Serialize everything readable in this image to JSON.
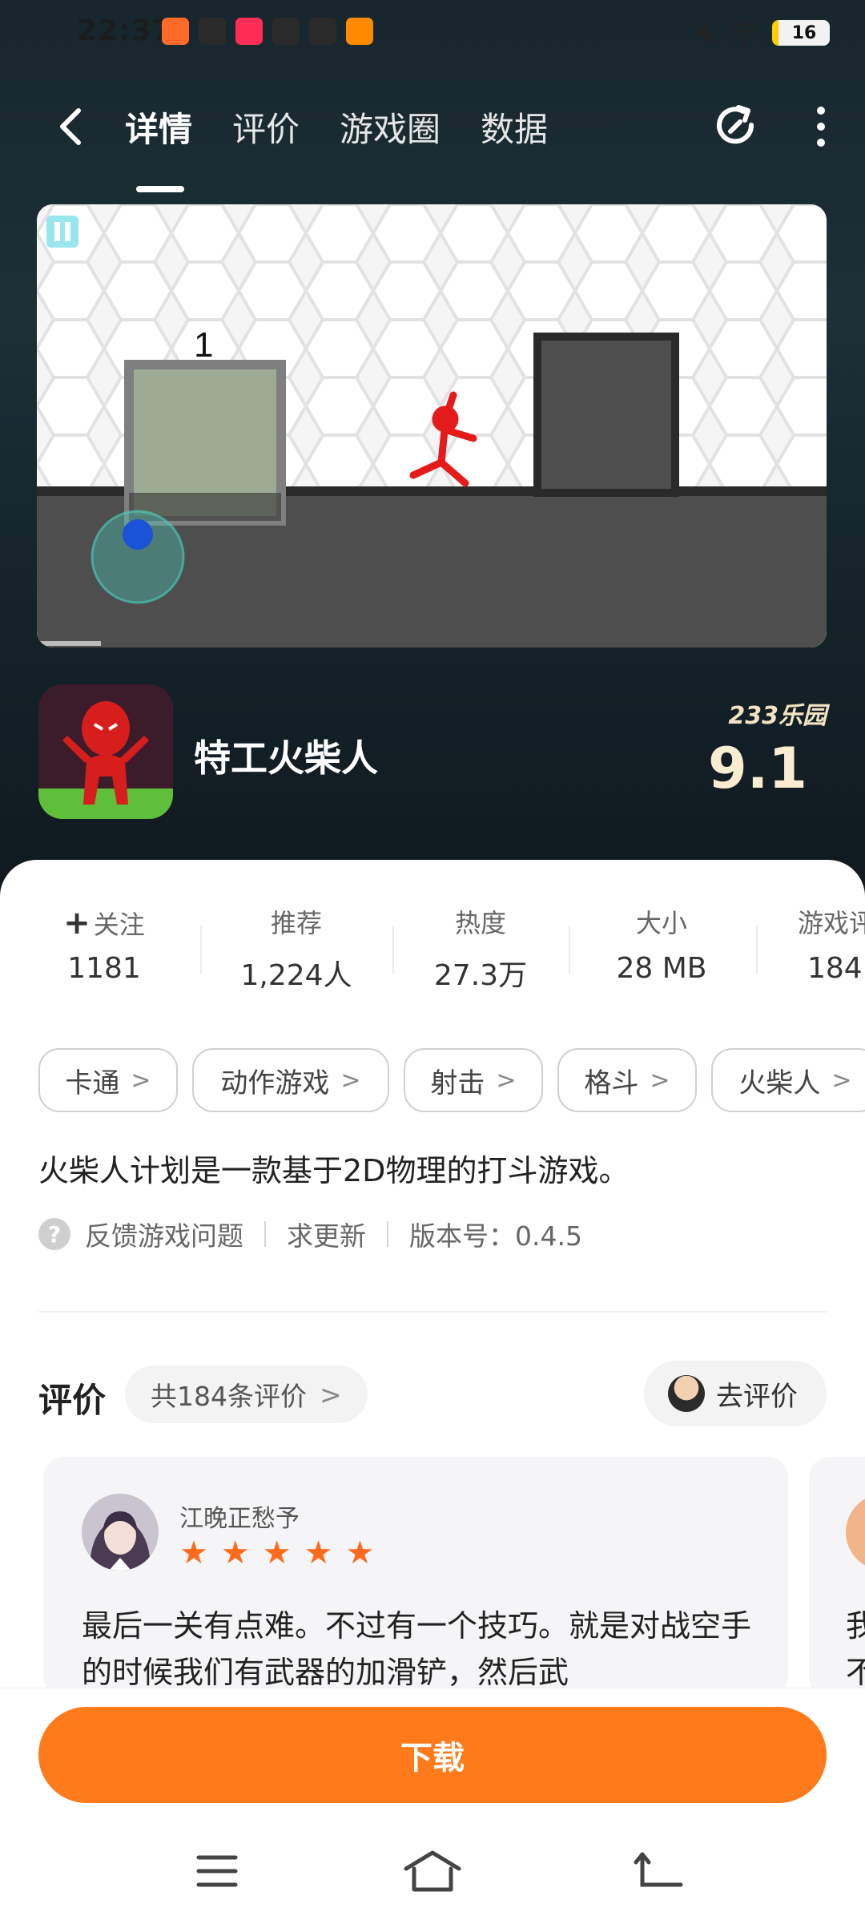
{
  "status_bar": {
    "time": "22:37",
    "battery": "16"
  },
  "nav": {
    "tabs": [
      {
        "label": "详情",
        "active": true
      },
      {
        "label": "评价",
        "active": false
      },
      {
        "label": "游戏圈",
        "active": false
      },
      {
        "label": "数据",
        "active": false
      }
    ]
  },
  "media": {
    "level_number": "1"
  },
  "app": {
    "name": "特工火柴人",
    "brand": "233乐园",
    "score": "9.1"
  },
  "stats": [
    {
      "label": "关注",
      "value": "1181"
    },
    {
      "label": "推荐",
      "value": "1,224人"
    },
    {
      "label": "热度",
      "value": "27.3万"
    },
    {
      "label": "大小",
      "value": "28  MB"
    },
    {
      "label": "游戏评",
      "value": "184"
    }
  ],
  "tags": [
    "卡通",
    "动作游戏",
    "射击",
    "格斗",
    "火柴人"
  ],
  "description": "火柴人计划是一款基于2D物理的打斗游戏。",
  "meta": {
    "feedback": "反馈游戏问题",
    "update": "求更新",
    "version": "版本号：0.4.5"
  },
  "reviews": {
    "title": "评价",
    "count": "共184条评价",
    "go_review": "去评价",
    "items": [
      {
        "user": "江晚正愁予",
        "stars": 5,
        "text": "最后一关有点难。不过有一个技巧。就是对战空手的时候我们有武器的加滑铲，然后武"
      }
    ],
    "peek_text": "我不"
  },
  "download": {
    "label": "下载"
  },
  "colors": {
    "accent": "#ff7a1a",
    "score": "#f9ecd1"
  }
}
